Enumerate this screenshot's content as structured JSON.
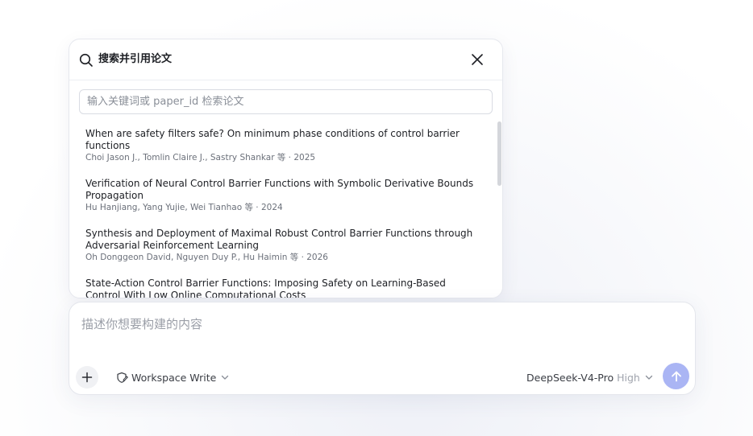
{
  "search_popup": {
    "title": "搜索并引用论文",
    "search_placeholder": "输入关键词或 paper_id 检索论文",
    "results": [
      {
        "title": "When are safety filters safe? On minimum phase conditions of control barrier functions",
        "meta": "Choi Jason J., Tomlin Claire J., Sastry Shankar 等 · 2025"
      },
      {
        "title": "Verification of Neural Control Barrier Functions with Symbolic Derivative Bounds Propagation",
        "meta": "Hu Hanjiang, Yang Yujie, Wei Tianhao 等 · 2024"
      },
      {
        "title": "Synthesis and Deployment of Maximal Robust Control Barrier Functions through Adversarial Reinforcement Learning",
        "meta": "Oh Donggeon David, Nguyen Duy P., Hu Haimin 等 · 2026"
      },
      {
        "title": "State-Action Control Barrier Functions: Imposing Safety on Learning-Based Control With Low Online Computational Costs",
        "meta": ""
      }
    ]
  },
  "composer": {
    "placeholder": "描述你想要构建的内容",
    "workspace_label": "Workspace Write",
    "model_name": "DeepSeek-V4-Pro",
    "model_effort": "High"
  },
  "icons": {
    "search": "search-icon",
    "close": "close-icon",
    "plus": "plus-icon",
    "workspace": "shield-edit-icon",
    "chevron": "chevron-down-icon",
    "send": "arrow-up-icon"
  },
  "colors": {
    "send_button": "#aab5f4",
    "text_primary": "#1d1f24",
    "text_secondary": "#6b707a"
  }
}
